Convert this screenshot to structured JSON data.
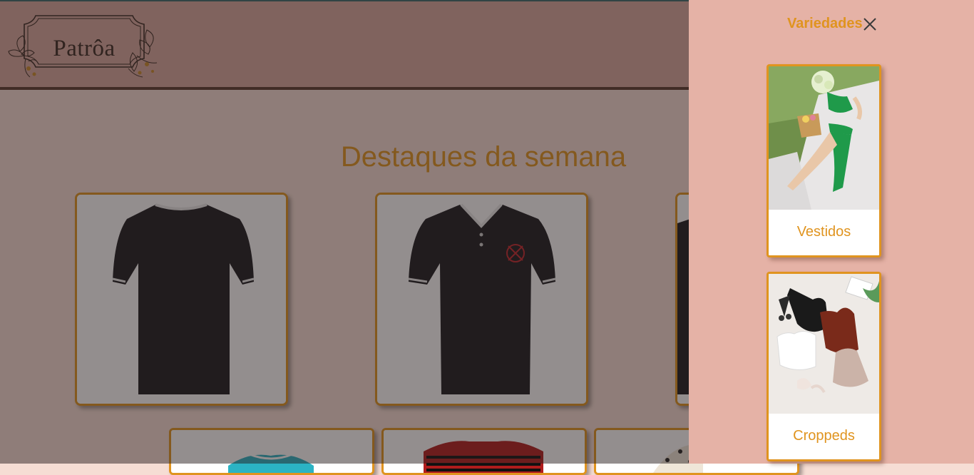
{
  "header": {
    "logo_text": "Patrôa"
  },
  "main": {
    "section_title": "Destaques da semana",
    "products": [
      {
        "name": "black-polo-back"
      },
      {
        "name": "black-polo-corinthians"
      },
      {
        "name": "black-polo-partial"
      }
    ],
    "products_row2": [
      {
        "name": "cyan-jersey"
      },
      {
        "name": "red-black-striped-jersey"
      },
      {
        "name": "animal-print-item"
      }
    ]
  },
  "panel": {
    "title": "Variedades",
    "close_icon": "close-icon",
    "categories": [
      {
        "label": "Vestidos",
        "image": "green-dress-photo"
      },
      {
        "label": "Croppeds",
        "image": "cropped-tops-photo"
      }
    ]
  },
  "colors": {
    "accent": "#e0941f",
    "header_bg": "#d9a89e",
    "panel_bg": "#e5b2a6",
    "page_bg": "#f6ddd4",
    "header_border": "#5a3b2e"
  }
}
